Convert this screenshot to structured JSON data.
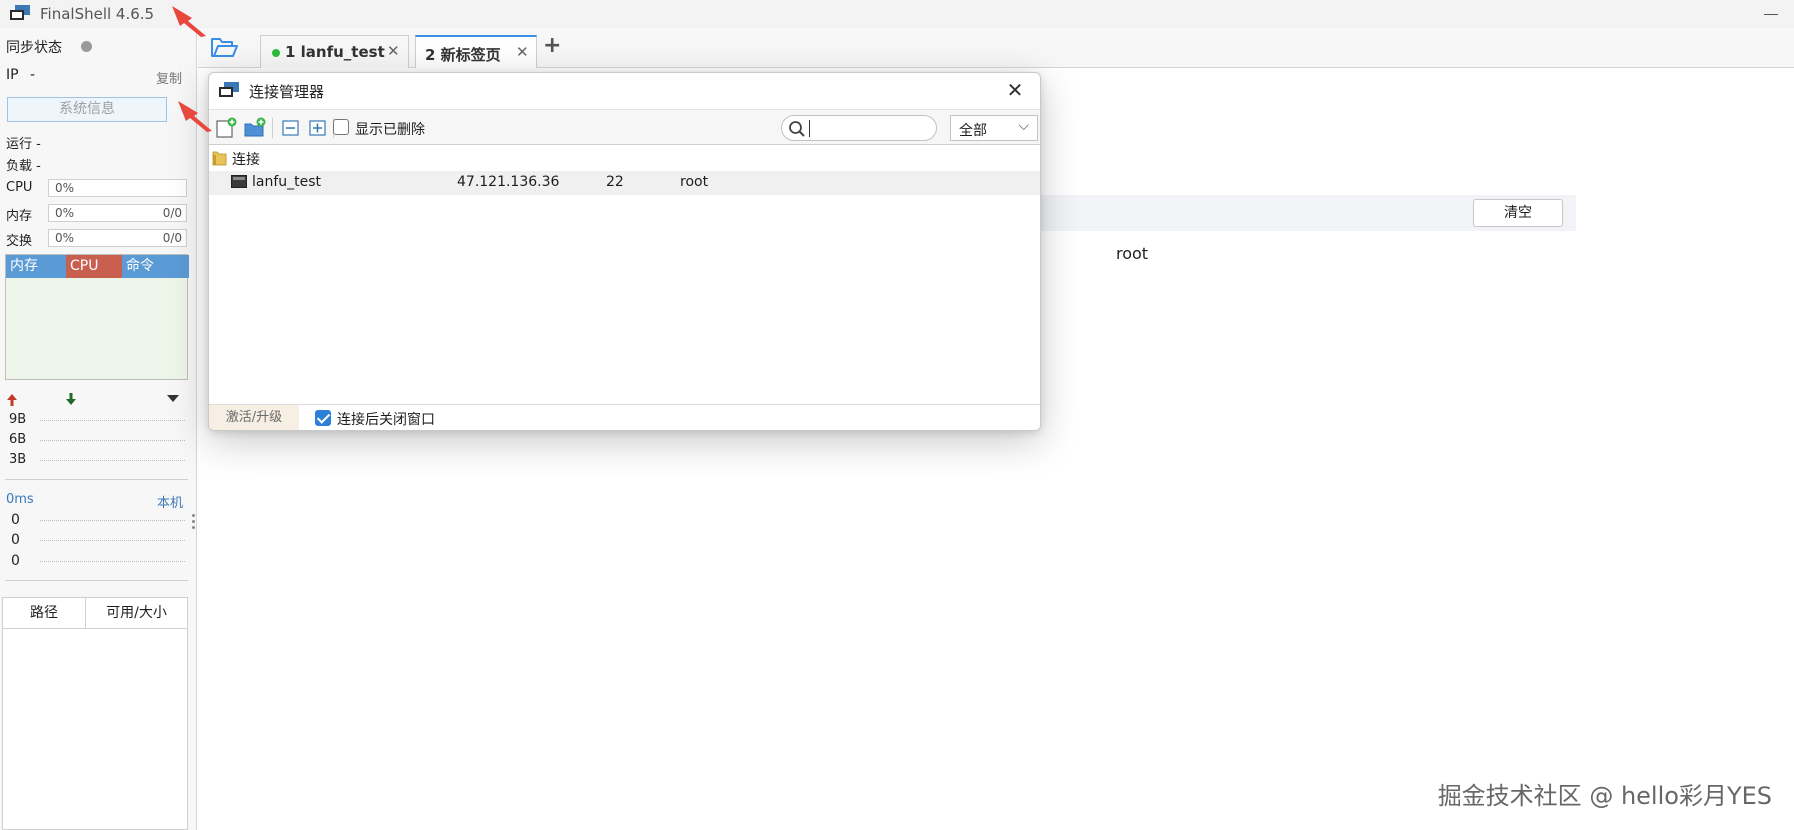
{
  "app": {
    "title": "FinalShell 4.6.5"
  },
  "sidebar": {
    "sync_label": "同步状态",
    "ip_label": "IP",
    "ip_value": "-",
    "copy_label": "复制",
    "sysinfo_button": "系统信息",
    "uptime_label": "运行 -",
    "load_label": "负载 -",
    "cpu": {
      "label": "CPU",
      "pct": "0%"
    },
    "mem": {
      "label": "内存",
      "pct": "0%",
      "ratio": "0/0"
    },
    "swap": {
      "label": "交换",
      "pct": "0%",
      "ratio": "0/0"
    },
    "proc_tabs": [
      "内存",
      "CPU",
      "命令"
    ],
    "net_scale": [
      "9B",
      "6B",
      "3B"
    ],
    "ping": {
      "latency": "0ms",
      "host": "本机",
      "values": [
        "0",
        "0",
        "0"
      ]
    },
    "disk_table": {
      "headers": [
        "路径",
        "可用/大小"
      ]
    }
  },
  "tabs": [
    {
      "label": "1 lanfu_test",
      "status": "connected"
    },
    {
      "label": "2 新标签页",
      "status": "active"
    }
  ],
  "main": {
    "clear_button": "清空",
    "user": "root"
  },
  "dialog": {
    "title": "连接管理器",
    "show_deleted_label": "显示已删除",
    "show_deleted_checked": false,
    "search": {
      "value": "",
      "placeholder": ""
    },
    "filter": "全部",
    "folder": "连接",
    "connections": [
      {
        "name": "lanfu_test",
        "host": "47.121.136.36",
        "port": "22",
        "user": "root"
      }
    ],
    "activate_button": "激活/升级",
    "close_after_connect_label": "连接后关闭窗口",
    "close_after_connect_checked": true
  },
  "watermark": "掘金技术社区 @ hello彩月YES",
  "colors": {
    "accent": "#3a8ee6",
    "proc_mem": "#5b9bd5",
    "proc_cpu": "#c9604f",
    "proc_cmd": "#5b9bd5",
    "connected_dot": "#2dbd3a",
    "arrow": "#e8473d"
  }
}
